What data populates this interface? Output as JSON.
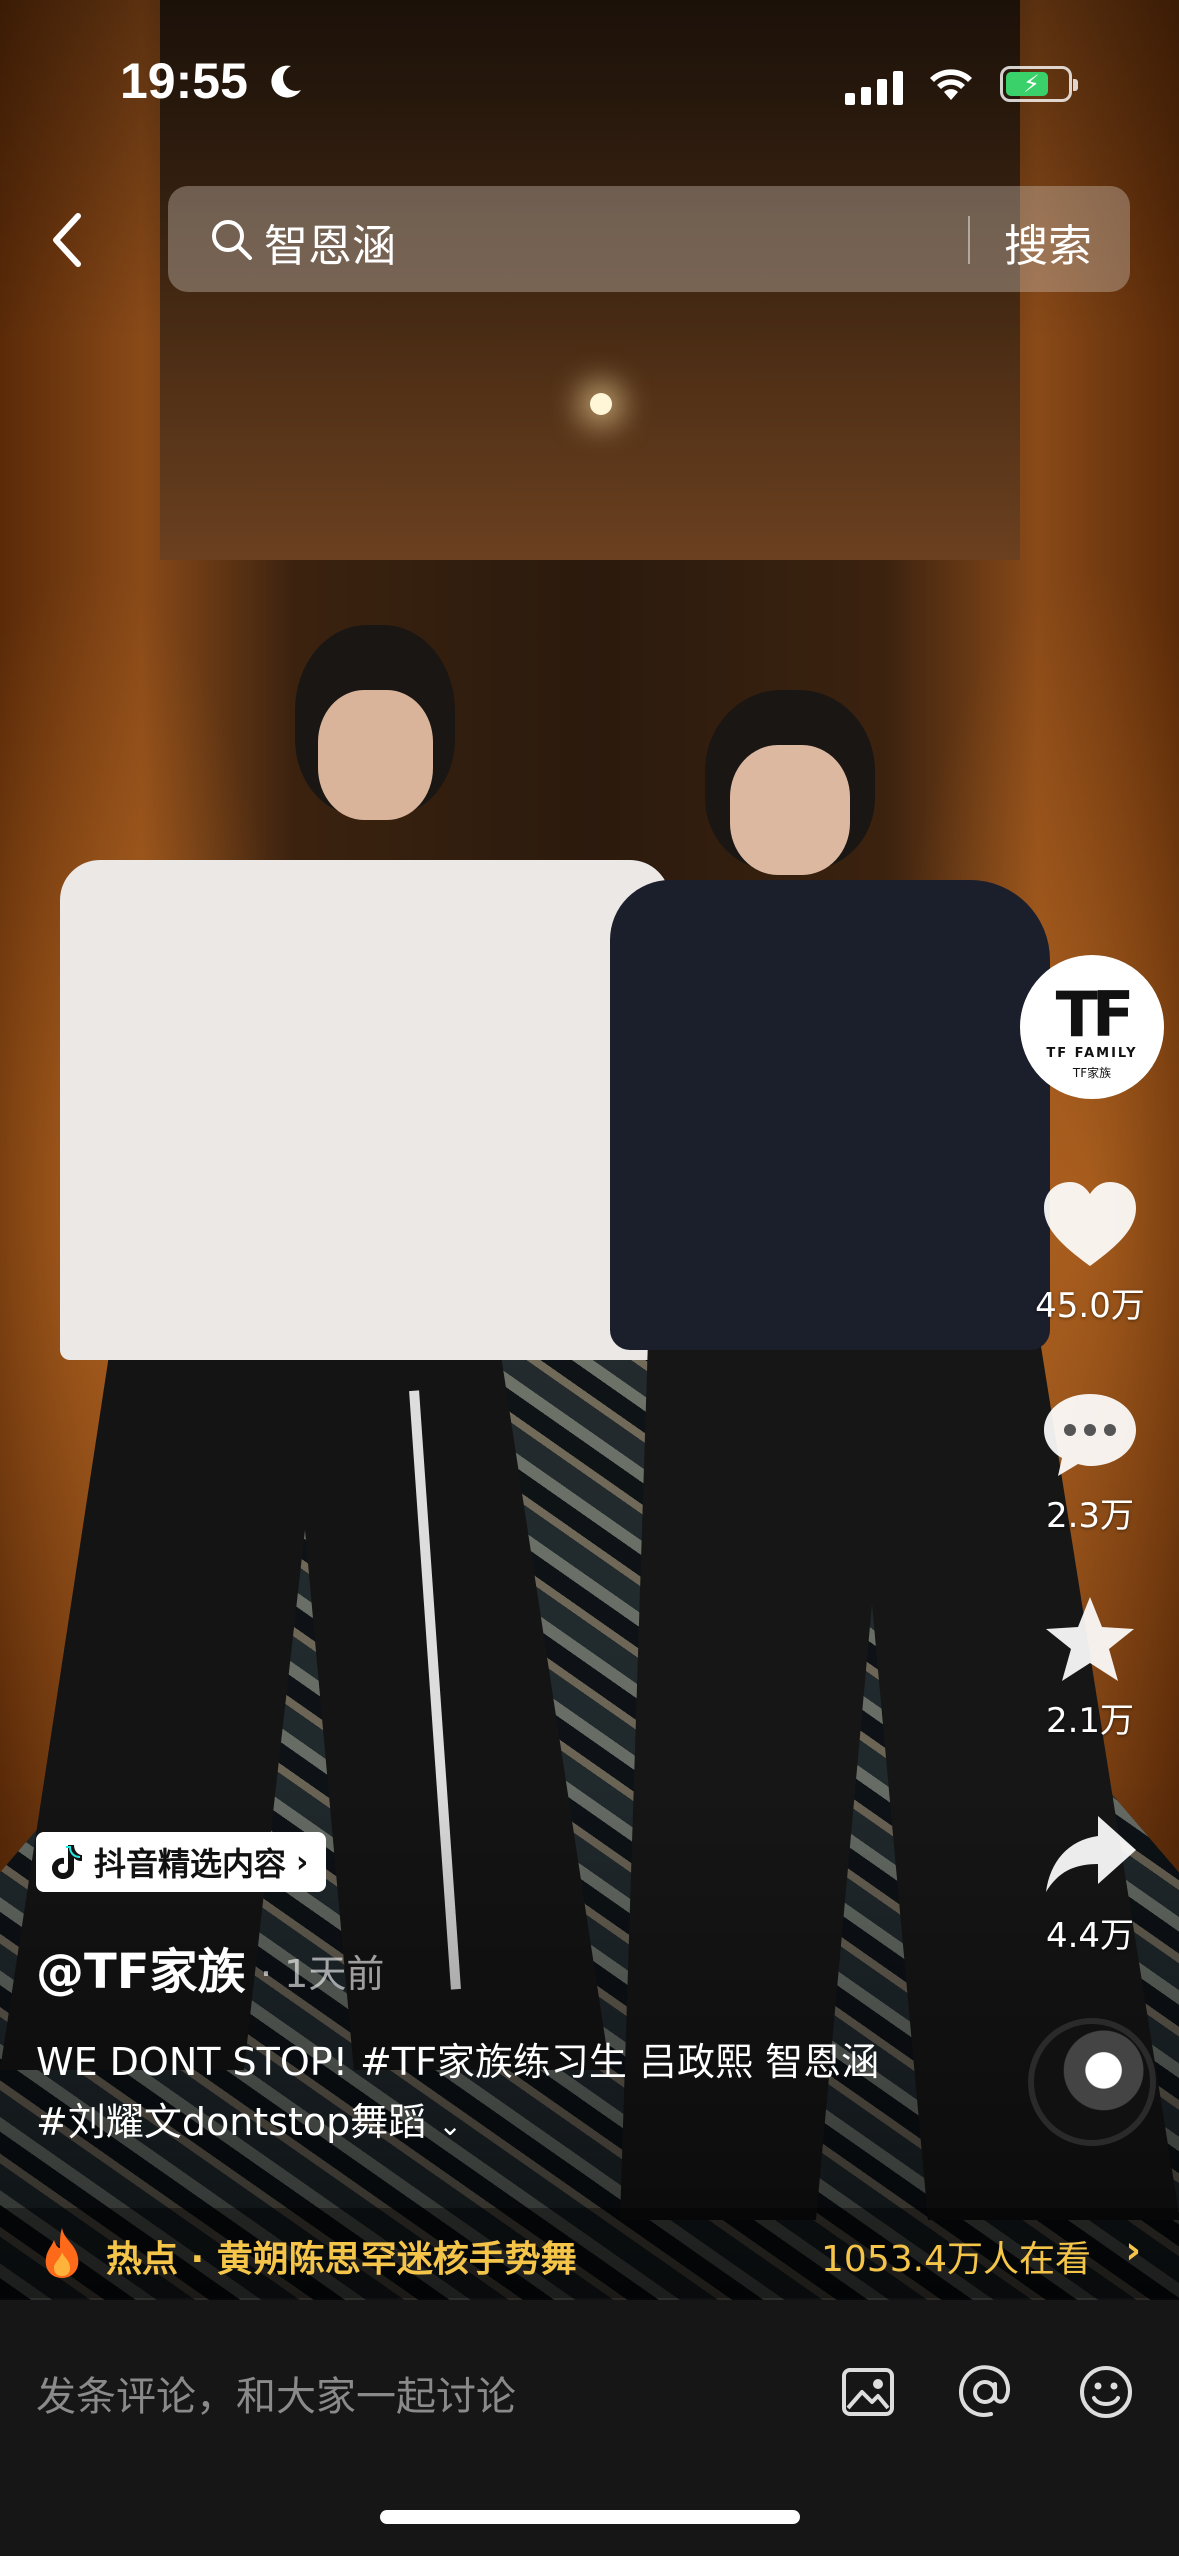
{
  "status_bar": {
    "time": "19:55",
    "battery_level": 0.7,
    "battery_color": "#3ad16a"
  },
  "search": {
    "query": "智恩涵",
    "button_label": "搜索"
  },
  "author_avatar": {
    "logo_text": "TF",
    "logo_sub_en": "TF FAMILY",
    "logo_sub_cn": "TF家族"
  },
  "actions": {
    "likes": "45.0万",
    "comments": "2.3万",
    "favorites": "2.1万",
    "shares": "4.4万"
  },
  "caption": {
    "badge_label": "抖音精选内容",
    "author": "@TF家族",
    "posted": "· 1天前",
    "description": "WE DONT STOP! #TF家族练习生 吕政熙 智恩涵 #刘耀文dontstop舞蹈"
  },
  "hot_banner": {
    "topic": "热点 · 黄朔陈思罕迷核手势舞",
    "viewers": "1053.4万人在看",
    "accent_color": "#f5c54a"
  },
  "comment_bar": {
    "placeholder": "发条评论，和大家一起讨论"
  },
  "icons": {
    "back": "chevron-left-icon",
    "search": "search-icon",
    "like": "heart-icon",
    "comment": "chat-bubble-icon",
    "favorite": "star-icon",
    "share": "share-arrow-icon",
    "image": "image-icon",
    "mention": "at-icon",
    "emoji": "emoji-icon"
  }
}
